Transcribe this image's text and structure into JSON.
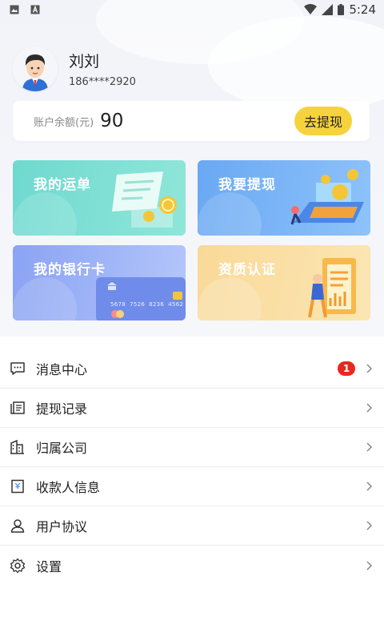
{
  "status_bar": {
    "time": "5:24",
    "left_icons": [
      "image-icon",
      "text-icon"
    ],
    "right_icons": [
      "wifi-icon",
      "signal-icon",
      "battery-icon"
    ]
  },
  "profile": {
    "name": "刘刘",
    "phone": "186****2920",
    "avatar": "avatar"
  },
  "balance": {
    "label": "账户余额(元)",
    "value": "90",
    "withdraw_label": "去提现",
    "accent": "#f6d33c"
  },
  "cards": [
    {
      "title": "我的运单",
      "color": "#6fd9d0"
    },
    {
      "title": "我要提现",
      "color": "#6aa8f3"
    },
    {
      "title": "我的银行卡",
      "color": "#8aa3f3"
    },
    {
      "title": "资质认证",
      "color": "#f9d998"
    }
  ],
  "bank_card_digits": "5678  7526  8236  4562",
  "menu": [
    {
      "label": "消息中心",
      "icon": "message-icon",
      "badge": "1"
    },
    {
      "label": "提现记录",
      "icon": "record-icon"
    },
    {
      "label": "归属公司",
      "icon": "building-icon"
    },
    {
      "label": "收款人信息",
      "icon": "receipt-icon"
    },
    {
      "label": "用户协议",
      "icon": "user-icon"
    },
    {
      "label": "设置",
      "icon": "gear-icon"
    }
  ],
  "badge_color": "#e9271f"
}
